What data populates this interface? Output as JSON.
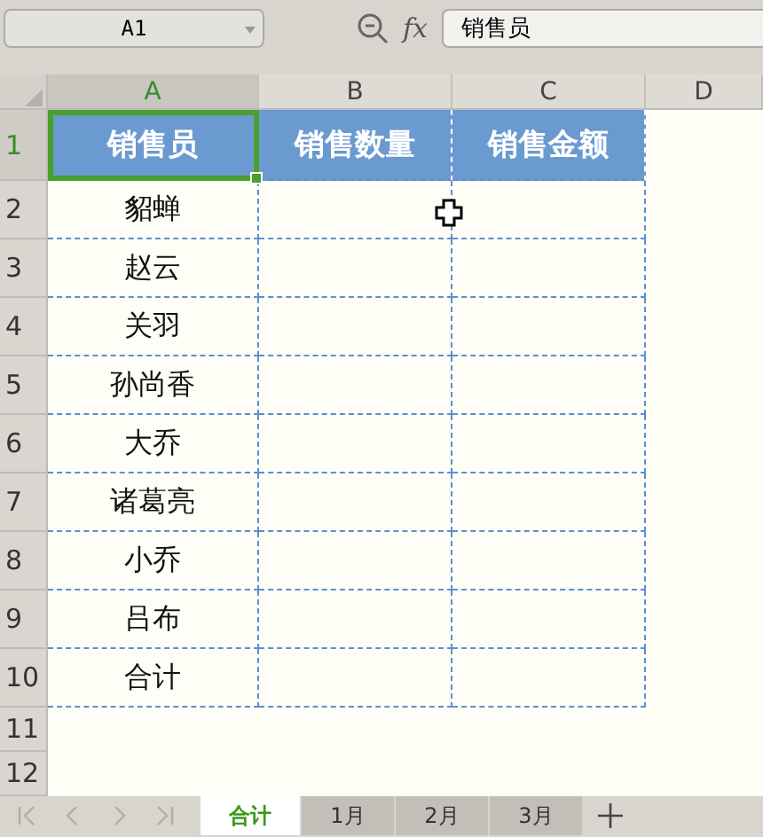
{
  "name_box": {
    "value": "A1"
  },
  "function_button": {
    "label": "fx"
  },
  "formula_bar": {
    "value": "销售员"
  },
  "columns": [
    {
      "label": "A",
      "selected": true
    },
    {
      "label": "B",
      "selected": false
    },
    {
      "label": "C",
      "selected": false
    },
    {
      "label": "D",
      "selected": false
    }
  ],
  "rows": [
    {
      "label": "1",
      "selected": true,
      "kind": "header",
      "cells": [
        "销售员",
        "销售数量",
        "销售金额"
      ]
    },
    {
      "label": "2",
      "selected": false,
      "kind": "data",
      "cells": [
        "貂蝉"
      ]
    },
    {
      "label": "3",
      "selected": false,
      "kind": "data",
      "cells": [
        "赵云"
      ]
    },
    {
      "label": "4",
      "selected": false,
      "kind": "data",
      "cells": [
        "关羽"
      ]
    },
    {
      "label": "5",
      "selected": false,
      "kind": "data",
      "cells": [
        "孙尚香"
      ]
    },
    {
      "label": "6",
      "selected": false,
      "kind": "data",
      "cells": [
        "大乔"
      ]
    },
    {
      "label": "7",
      "selected": false,
      "kind": "data",
      "cells": [
        "诸葛亮"
      ]
    },
    {
      "label": "8",
      "selected": false,
      "kind": "data",
      "cells": [
        "小乔"
      ]
    },
    {
      "label": "9",
      "selected": false,
      "kind": "data",
      "cells": [
        "吕布"
      ]
    },
    {
      "label": "10",
      "selected": false,
      "kind": "data",
      "cells": [
        "合计"
      ]
    },
    {
      "label": "11",
      "selected": false,
      "kind": "blank"
    },
    {
      "label": "12",
      "selected": false,
      "kind": "blank"
    }
  ],
  "sheet_tabs": [
    {
      "label": "合计",
      "selected": true
    },
    {
      "label": "1月",
      "selected": false
    },
    {
      "label": "2月",
      "selected": false
    },
    {
      "label": "3月",
      "selected": false
    }
  ]
}
